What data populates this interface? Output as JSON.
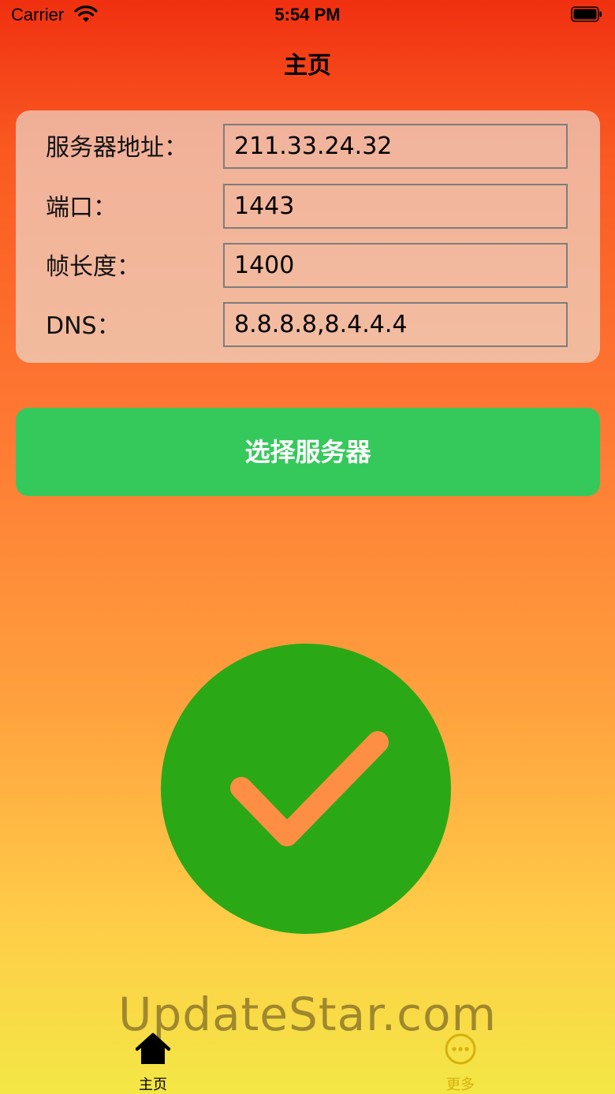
{
  "status_bar": {
    "carrier": "Carrier",
    "time": "5:54 PM",
    "wifi_icon": "wifi-icon",
    "battery_icon": "battery-icon"
  },
  "nav": {
    "title": "主页"
  },
  "settings": {
    "fields": [
      {
        "label": "服务器地址：",
        "value": "211.33.24.32"
      },
      {
        "label": "端口：",
        "value": "1443"
      },
      {
        "label": "帧长度：",
        "value": "1400"
      },
      {
        "label": "DNS：",
        "value": "8.8.8.8,8.4.4.4"
      }
    ]
  },
  "actions": {
    "select_server_label": "选择服务器"
  },
  "status": {
    "icon": "checkmark-icon",
    "circle_color": "#2ba816",
    "check_color": "#fe8e44"
  },
  "watermark": "UpdateStar.com",
  "tab_bar": {
    "tabs": [
      {
        "label": "主页",
        "icon": "home-icon",
        "color": "#000000"
      },
      {
        "label": "更多",
        "icon": "more-icon",
        "color": "#d5b10e"
      }
    ]
  },
  "colors": {
    "accent_green": "#35c95b",
    "background_top": "#f03010",
    "background_bottom": "#f3e745"
  }
}
